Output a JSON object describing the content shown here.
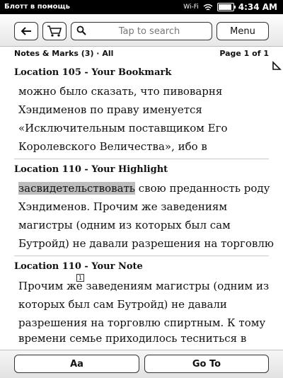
{
  "status_bar": {
    "carrier": "Блотт в помощь",
    "wifi": "Wi-Fi",
    "time": "4:34 AM"
  },
  "toolbar": {
    "back_icon": "back-arrow-icon",
    "store_icon": "cart-icon",
    "search_icon": "magnifier-icon",
    "search_placeholder": "Tap to search",
    "menu_label": "Menu"
  },
  "subheader": {
    "left": "Notes & Marks (3) · All",
    "pager": "Page 1 of 1"
  },
  "entries": [
    {
      "title": "Location 105 - Your Bookmark",
      "lines": [
        "можно было сказать, что пивоварня",
        "Хэндименов по праву именуется",
        "«Исключительным поставщиком Его",
        "Королевского Величества», ибо в"
      ]
    },
    {
      "title": "Location 110 - Your Highlight",
      "highlight": "засвидетельствовать",
      "line1_rest": " свою преданность роду",
      "lines": [
        "Хэндименов. Прочим же заведениям",
        "магистры (одним из которых был сам",
        "Бутройд) не давали разрешения на торговлю"
      ]
    },
    {
      "title": "Location 110 - Your Note",
      "note_marker": "1",
      "lines": [
        "Прочим же заведениям магистры (одним из",
        "которых был сам Бутройд) не давали",
        "разрешения на торговлю спиртным. К тому",
        "времени семье приходилось тесниться в"
      ]
    }
  ],
  "bottom_bar": {
    "aa_label": "Aa",
    "goto_label": "Go To"
  }
}
